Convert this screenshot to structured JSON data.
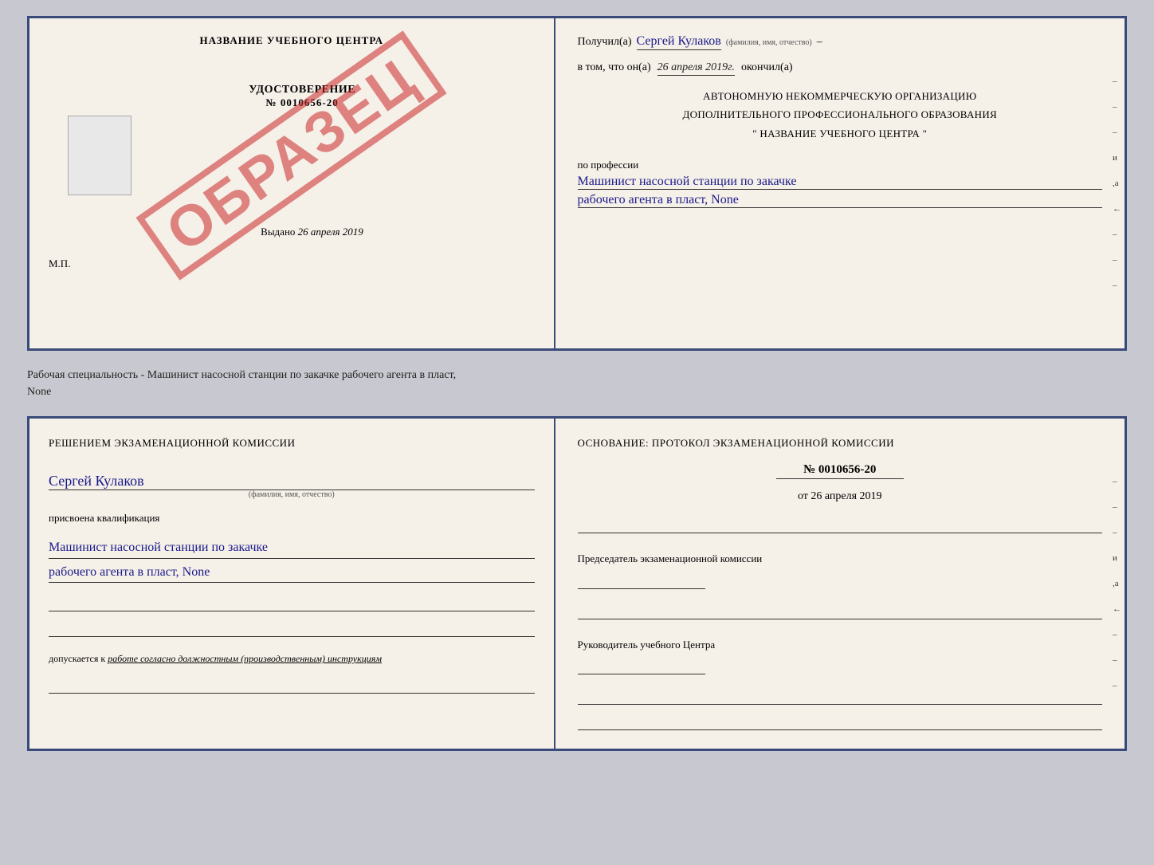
{
  "top_doc": {
    "left": {
      "training_center": "НАЗВАНИЕ УЧЕБНОГО ЦЕНТРА",
      "stamp_text": "ОБРАЗЕЦ",
      "certificate_title": "УДОСТОВЕРЕНИЕ",
      "certificate_num": "№ 0010656-20",
      "vydano_label": "Выдано",
      "vydano_date": "26 апреля 2019",
      "mp_label": "М.П."
    },
    "right": {
      "received_prefix": "Получил(а)",
      "person_name": "Сергей Кулаков",
      "fio_hint": "(фамилия, имя, отчество)",
      "date_prefix": "в том, что он(а)",
      "date_value": "26 апреля 2019г.",
      "date_suffix": "окончил(а)",
      "org_line1": "АВТОНОМНУЮ НЕКОММЕРЧЕСКУЮ ОРГАНИЗАЦИЮ",
      "org_line2": "ДОПОЛНИТЕЛЬНОГО ПРОФЕССИОНАЛЬНОГО ОБРАЗОВАНИЯ",
      "org_name": "\" НАЗВАНИЕ УЧЕБНОГО ЦЕНТРА \"",
      "profession_label": "по профессии",
      "profession_line1": "Машинист насосной станции по закачке",
      "profession_line2": "рабочего агента в пласт, None",
      "side_marks": [
        "-",
        "-",
        "-",
        "и",
        ",а",
        "←",
        "-",
        "-",
        "-"
      ]
    }
  },
  "status_text": {
    "line1": "Рабочая специальность - Машинист насосной станции по закачке рабочего агента в пласт,",
    "line2": "None"
  },
  "bottom_doc": {
    "left": {
      "commission_title": "Решением экзаменационной комиссии",
      "person_name": "Сергей Кулаков",
      "fio_hint": "(фамилия, имя, отчество)",
      "assigned_label": "присвоена квалификация",
      "qualification_line1": "Машинист насосной станции по закачке",
      "qualification_line2": "рабочего агента в пласт, None",
      "allowed_prefix": "допускается к",
      "allowed_italic": "работе согласно должностным (производственным) инструкциям"
    },
    "right": {
      "osnov_title": "Основание: протокол экзаменационной комиссии",
      "protocol_num": "№ 0010656-20",
      "date_prefix": "от",
      "date_value": "26 апреля 2019",
      "chairman_title": "Председатель экзаменационной комиссии",
      "head_title": "Руководитель учебного Центра",
      "side_marks": [
        "-",
        "-",
        "-",
        "и",
        ",а",
        "←",
        "-",
        "-",
        "-"
      ]
    }
  }
}
